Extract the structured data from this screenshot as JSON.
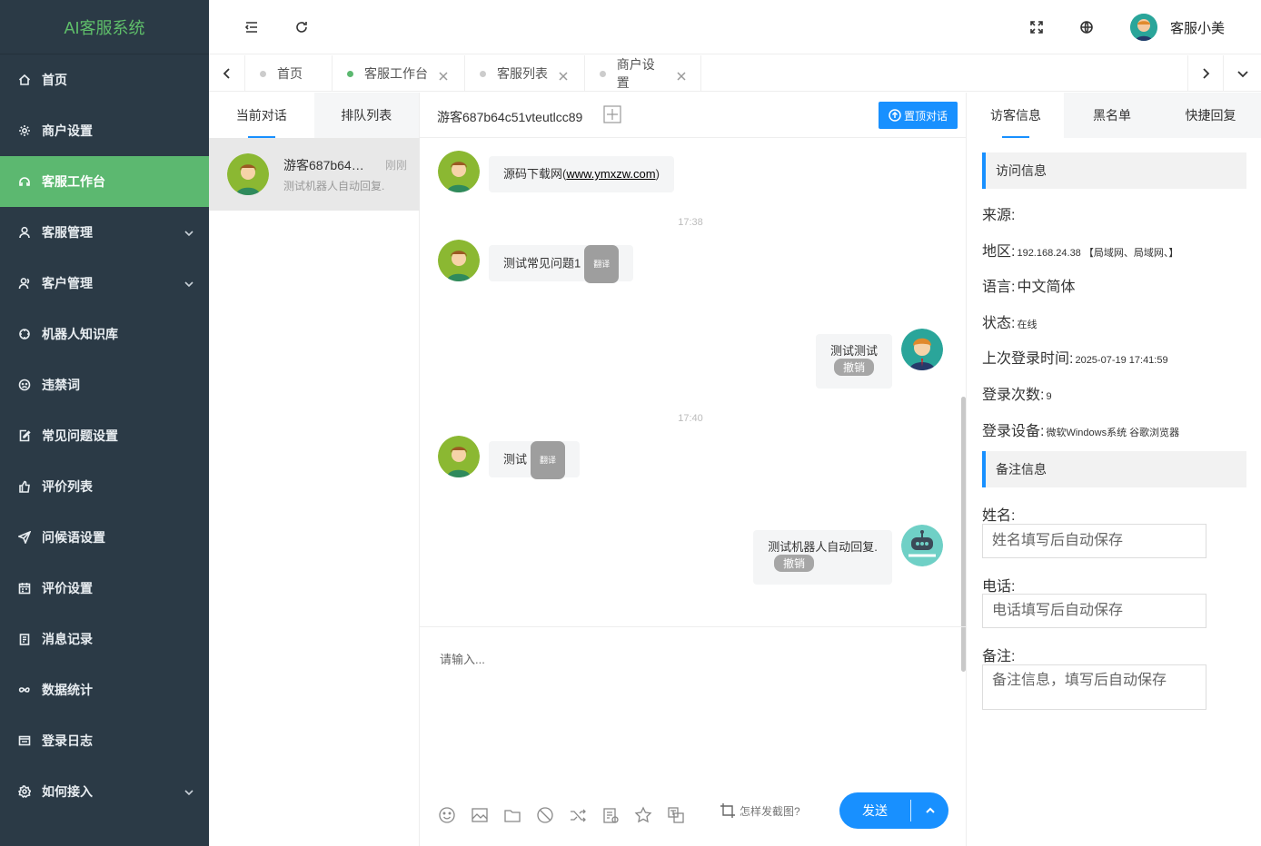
{
  "app": {
    "title": "AI客服系统",
    "accent": "#5cb870",
    "primary": "#1890ff"
  },
  "sidebar": {
    "items": [
      {
        "label": "首页",
        "icon": "home-icon"
      },
      {
        "label": "商户设置",
        "icon": "gear-icon"
      },
      {
        "label": "客服工作台",
        "icon": "headset-icon",
        "active": true
      },
      {
        "label": "客服管理",
        "icon": "user-icon",
        "expandable": true
      },
      {
        "label": "客户管理",
        "icon": "users-icon",
        "expandable": true
      },
      {
        "label": "机器人知识库",
        "icon": "robot-icon"
      },
      {
        "label": "违禁词",
        "icon": "frown-icon"
      },
      {
        "label": "常见问题设置",
        "icon": "edit-doc-icon"
      },
      {
        "label": "评价列表",
        "icon": "thumbs-up-icon"
      },
      {
        "label": "问候语设置",
        "icon": "send-icon"
      },
      {
        "label": "评价设置",
        "icon": "calendar-icon"
      },
      {
        "label": "消息记录",
        "icon": "clipboard-icon"
      },
      {
        "label": "数据统计",
        "icon": "infinity-icon"
      },
      {
        "label": "登录日志",
        "icon": "window-icon"
      },
      {
        "label": "如何接入",
        "icon": "settings-alt-icon",
        "expandable": true
      }
    ]
  },
  "topbar": {
    "user_name": "客服小美"
  },
  "tabs": [
    {
      "label": "首页",
      "active": false,
      "closable": false
    },
    {
      "label": "客服工作台",
      "active": true,
      "closable": true
    },
    {
      "label": "客服列表",
      "active": false,
      "closable": true
    },
    {
      "label": "商户设置",
      "active": false,
      "closable": true
    }
  ],
  "conv_list": {
    "tabs": [
      "当前对话",
      "排队列表"
    ],
    "items": [
      {
        "name": "游客687b64c51vteutlcc89",
        "time": "刚刚",
        "preview": "测试机器人自动回复."
      }
    ]
  },
  "chat": {
    "title": "游客687b64c51vteutlcc89",
    "pin_label": "置顶对话",
    "messages": [
      {
        "side": "left",
        "text": "源码下载网(",
        "link": "www.ymxzw.com",
        "suffix": ")"
      },
      {
        "time": "17:38"
      },
      {
        "side": "left",
        "text": "测试常见问题1",
        "tag": "翻译"
      },
      {
        "side": "right",
        "text": "测试测试",
        "tag": "撤销"
      },
      {
        "time": "17:40"
      },
      {
        "side": "left",
        "text": "测试",
        "tag": "翻译"
      },
      {
        "side": "right",
        "text": "测试机器人自动回复.",
        "tag": "撤销"
      }
    ],
    "input_placeholder": "请输入...",
    "screenshot_help": "怎样发截图?",
    "send_label": "发送",
    "tools": [
      "emoji-icon",
      "image-icon",
      "folder-icon",
      "block-icon",
      "transfer-icon",
      "notes-icon",
      "star-icon",
      "translate-icon"
    ]
  },
  "right_panel": {
    "tabs": [
      "访客信息",
      "黑名单",
      "快捷回复"
    ],
    "visit_section": "访问信息",
    "info": [
      {
        "label": "来源:",
        "value": ""
      },
      {
        "label": "地区:",
        "value": "192.168.24.38 【局域网、局域网、】"
      },
      {
        "label": "语言:",
        "value": "中文简体"
      },
      {
        "label": "状态:",
        "value": "在线"
      },
      {
        "label": "上次登录时间:",
        "value": "2025-07-19 17:41:59"
      },
      {
        "label": "登录次数:",
        "value": "9"
      },
      {
        "label": "登录设备:",
        "value": "微软Windows系统 谷歌浏览器"
      }
    ],
    "note_section": "备注信息",
    "form": {
      "name_label": "姓名:",
      "name_placeholder": "姓名填写后自动保存",
      "phone_label": "电话:",
      "phone_placeholder": "电话填写后自动保存",
      "remark_label": "备注:",
      "remark_placeholder": "备注信息，填写后自动保存"
    }
  }
}
